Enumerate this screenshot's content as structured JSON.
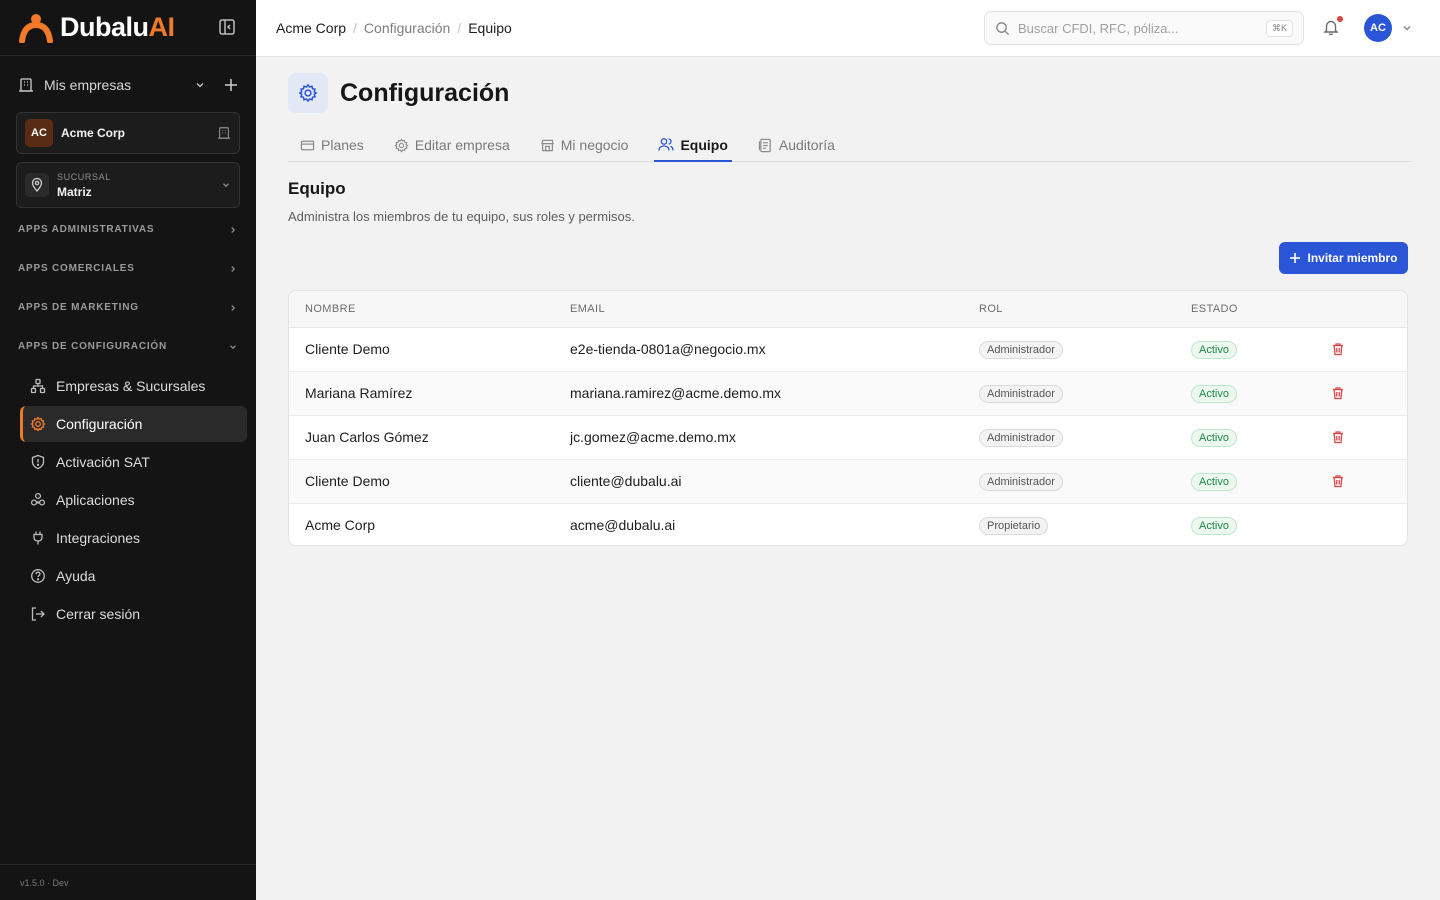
{
  "app": {
    "brand_part1": "Dubalu",
    "brand_part2": "AI",
    "version": "v1.5.0 · Dev"
  },
  "sidebar": {
    "mis_empresas": "Mis empresas",
    "company": {
      "initials": "AC",
      "name": "Acme Corp"
    },
    "branch": {
      "label": "SUCURSAL",
      "value": "Matriz"
    },
    "sections": [
      {
        "label": "APPS ADMINISTRATIVAS"
      },
      {
        "label": "APPS COMERCIALES"
      },
      {
        "label": "APPS DE MARKETING"
      },
      {
        "label": "APPS DE CONFIGURACIÓN"
      }
    ],
    "items": [
      {
        "label": "Empresas & Sucursales",
        "icon": "sitemap-icon"
      },
      {
        "label": "Configuración",
        "icon": "gear-icon"
      },
      {
        "label": "Activación SAT",
        "icon": "shield-icon"
      },
      {
        "label": "Aplicaciones",
        "icon": "apps-icon"
      },
      {
        "label": "Integraciones",
        "icon": "plug-icon"
      },
      {
        "label": "Ayuda",
        "icon": "help-icon"
      },
      {
        "label": "Cerrar sesión",
        "icon": "logout-icon"
      }
    ]
  },
  "topbar": {
    "breadcrumb": [
      "Acme Corp",
      "Configuración",
      "Equipo"
    ],
    "search_placeholder": "Buscar CFDI, RFC, póliza...",
    "search_shortcut": "⌘K",
    "user_initials": "AC"
  },
  "page": {
    "title": "Configuración",
    "tabs": [
      {
        "label": "Planes"
      },
      {
        "label": "Editar empresa"
      },
      {
        "label": "Mi negocio"
      },
      {
        "label": "Equipo"
      },
      {
        "label": "Auditoría"
      }
    ],
    "section_title": "Equipo",
    "section_desc": "Administra los miembros de tu equipo, sus roles y permisos.",
    "invite_label": "Invitar miembro"
  },
  "table": {
    "headers": {
      "name": "NOMBRE",
      "email": "EMAIL",
      "role": "ROL",
      "status": "ESTADO"
    },
    "rows": [
      {
        "name": "Cliente Demo",
        "email": "e2e-tienda-0801a@negocio.mx",
        "role": "Administrador",
        "status": "Activo"
      },
      {
        "name": "Mariana Ramírez",
        "email": "mariana.ramirez@acme.demo.mx",
        "role": "Administrador",
        "status": "Activo"
      },
      {
        "name": "Juan Carlos Gómez",
        "email": "jc.gomez@acme.demo.mx",
        "role": "Administrador",
        "status": "Activo"
      },
      {
        "name": "Cliente Demo",
        "email": "cliente@dubalu.ai",
        "role": "Administrador",
        "status": "Activo"
      },
      {
        "name": "Acme Corp",
        "email": "acme@dubalu.ai",
        "role": "Propietario",
        "status": "Activo"
      }
    ]
  },
  "colors": {
    "accent": "#2a55d6",
    "brand_orange": "#f07a2a",
    "sidebar_bg": "#141414",
    "danger": "#e04545",
    "success": "#1d8a4a"
  }
}
